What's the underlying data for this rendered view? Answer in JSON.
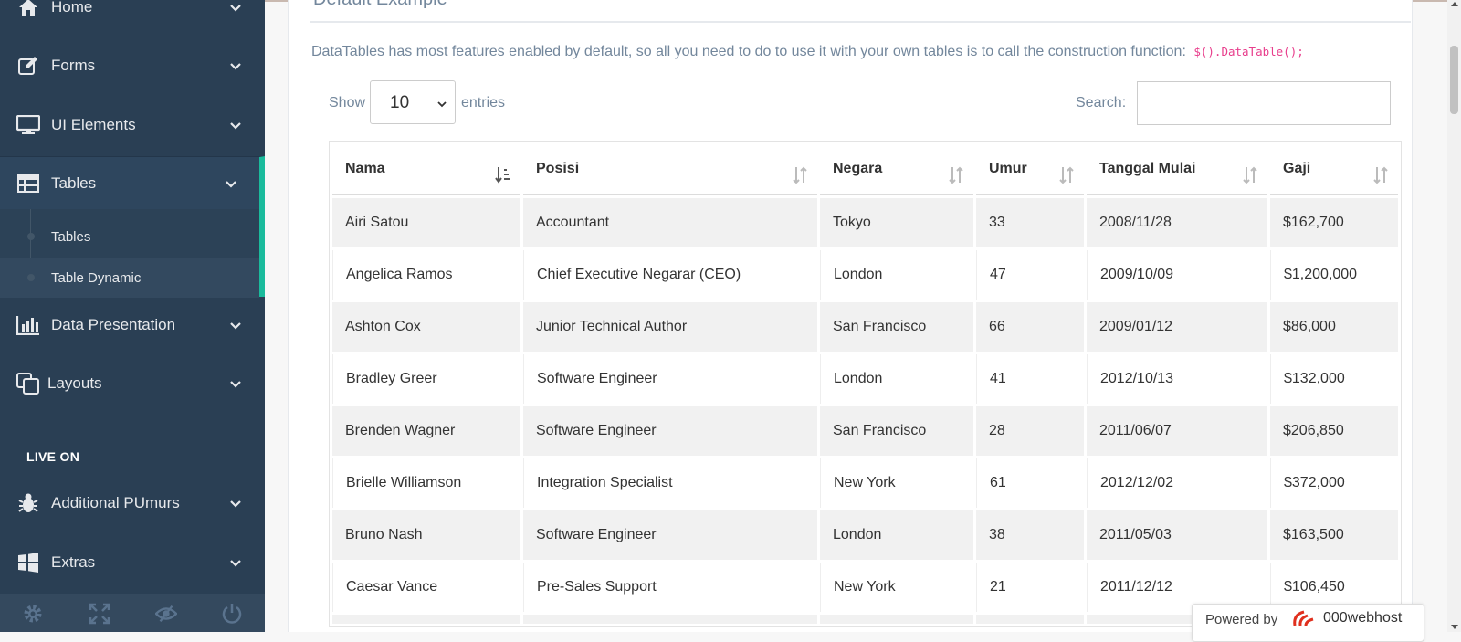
{
  "sidebar": {
    "items": [
      {
        "label": "Home",
        "icon": "home-icon"
      },
      {
        "label": "Forms",
        "icon": "edit-icon"
      },
      {
        "label": "UI Elements",
        "icon": "desktop-icon"
      },
      {
        "label": "Tables",
        "icon": "table-icon"
      },
      {
        "label": "Data Presentation",
        "icon": "bar-chart-icon"
      },
      {
        "label": "Layouts",
        "icon": "clone-icon"
      },
      {
        "label": "Additional PUmurs",
        "icon": "bug-icon"
      },
      {
        "label": "Extras",
        "icon": "windows-icon"
      }
    ],
    "subitems": [
      {
        "label": "Tables"
      },
      {
        "label": "Table Dynamic"
      }
    ],
    "section_label": "LIVE ON",
    "footer_icons": [
      "settings-icon",
      "fullscreen-icon",
      "lock-icon",
      "power-icon"
    ]
  },
  "panel": {
    "title": "Default Example",
    "description": "DataTables has most features enabled by default, so all you need to do to use it with your own tables is to call the construction function:",
    "code": "$().DataTable();"
  },
  "controls": {
    "show_label": "Show",
    "page_length": "10",
    "entries_label": "entries",
    "search_label": "Search:",
    "search_value": ""
  },
  "table": {
    "columns": [
      "Nama",
      "Posisi",
      "Negara",
      "Umur",
      "Tanggal Mulai",
      "Gaji"
    ],
    "rows": [
      [
        "Airi Satou",
        "Accountant",
        "Tokyo",
        "33",
        "2008/11/28",
        "$162,700"
      ],
      [
        "Angelica Ramos",
        "Chief Executive Negarar (CEO)",
        "London",
        "47",
        "2009/10/09",
        "$1,200,000"
      ],
      [
        "Ashton Cox",
        "Junior Technical Author",
        "San Francisco",
        "66",
        "2009/01/12",
        "$86,000"
      ],
      [
        "Bradley Greer",
        "Software Engineer",
        "London",
        "41",
        "2012/10/13",
        "$132,000"
      ],
      [
        "Brenden Wagner",
        "Software Engineer",
        "San Francisco",
        "28",
        "2011/06/07",
        "$206,850"
      ],
      [
        "Brielle Williamson",
        "Integration Specialist",
        "New York",
        "61",
        "2012/12/02",
        "$372,000"
      ],
      [
        "Bruno Nash",
        "Software Engineer",
        "London",
        "38",
        "2011/05/03",
        "$163,500"
      ],
      [
        "Caesar Vance",
        "Pre-Sales Support",
        "New York",
        "21",
        "2011/12/12",
        "$106,450"
      ]
    ]
  },
  "badge": {
    "powered_by": "Powered by",
    "brand": "000webhost"
  },
  "colors": {
    "sidebar_bg": "#2a3f54",
    "accent": "#1abb9c",
    "code": "#e83e8c"
  }
}
